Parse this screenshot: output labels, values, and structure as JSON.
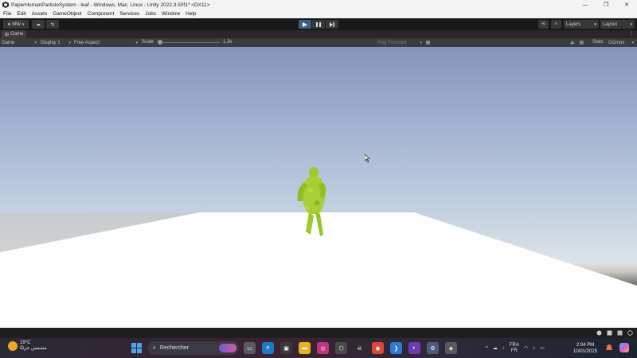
{
  "window": {
    "title": "PaperHumanParticleSystem - leaf - Windows, Mac, Linux - Unity 2022.3.50f1* <DX11>",
    "controls": [
      "minimize",
      "maximize",
      "close"
    ]
  },
  "menu": [
    "File",
    "Edit",
    "Assets",
    "GameObject",
    "Component",
    "Services",
    "Jobs",
    "Window",
    "Help"
  ],
  "toolbar": {
    "account_label": "MW",
    "layers_label": "Layers",
    "layout_label": "Layout"
  },
  "game_tab": {
    "label": "Game"
  },
  "game_controls": {
    "view_mode": "Game",
    "display": "Display 1",
    "aspect": "Free Aspect",
    "scale_label": "Scale",
    "scale_value": "1.3x",
    "play_mode": "Play Focused",
    "stats_label": "Stats",
    "gizmos_label": "Gizmos"
  },
  "taskbar": {
    "weather_temp": "19°C",
    "weather_desc": "مشمس جزئيًا",
    "search_placeholder": "Rechercher",
    "lang_top": "FRA",
    "lang_bottom": "FR",
    "time": "2:04 PM",
    "date": "10/01/2025"
  },
  "colors": {
    "play_active": "#3c5f85",
    "editor_dark": "#191919",
    "panel": "#3c3c3c",
    "leaf_green": "#9ccc2c"
  }
}
